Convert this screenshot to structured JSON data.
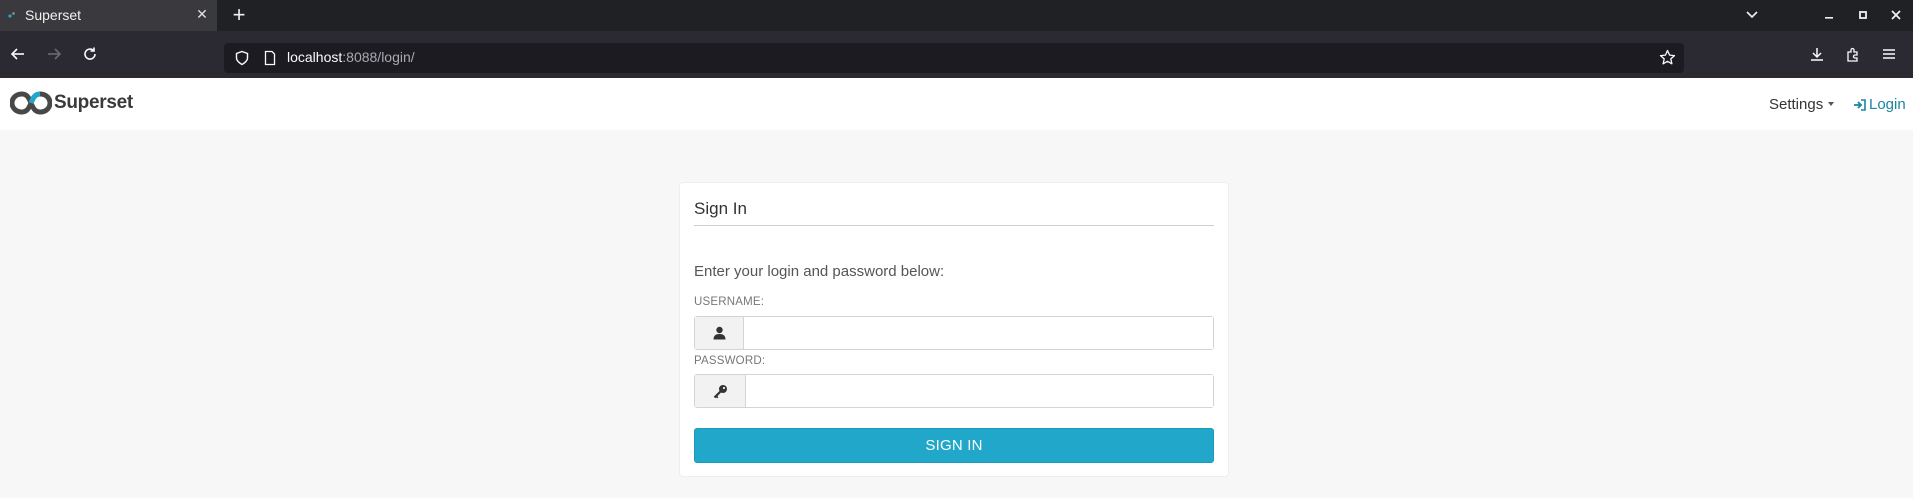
{
  "browser": {
    "tab_title": "Superset",
    "url_host": "localhost",
    "url_path": ":8088/login/"
  },
  "header": {
    "brand": "Superset",
    "settings_label": "Settings",
    "login_label": "Login"
  },
  "login_form": {
    "title": "Sign In",
    "subtitle": "Enter your login and password below:",
    "username_label": "USERNAME:",
    "username_value": "",
    "password_label": "PASSWORD:",
    "password_value": "",
    "submit_label": "SIGN IN"
  },
  "colors": {
    "accent": "#20a7c9",
    "link": "#1a85a0",
    "brand_logo_primary": "#484848",
    "brand_logo_accent": "#20a7c9"
  },
  "icons": {
    "username": "user-icon",
    "password": "key-icon",
    "login": "sign-in-icon"
  }
}
